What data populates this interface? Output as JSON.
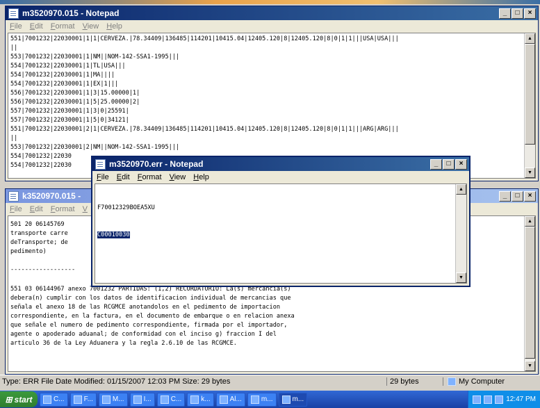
{
  "back_window": {
    "title": "m3520970.015 - Notepad",
    "menu": [
      "File",
      "Edit",
      "Format",
      "View",
      "Help"
    ],
    "lines": [
      "551|7001232|22030001|1|1|CERVEZA.|78.34409|136485|114201|10415.04|12405.120|8|12405.120|8|0|1|1|||USA|USA|||",
      "||",
      "553|7001232|22030001|1|NM||NOM-142-SSA1-1995|||",
      "554|7001232|22030001|1|TL|USA|||",
      "554|7001232|22030001|1|MA||||",
      "554|7001232|22030001|1|EX|1|||",
      "556|7001232|22030001|1|3|15.00000|1|",
      "556|7001232|22030001|1|5|25.00000|2|",
      "557|7001232|22030001|1|3|0|25591|",
      "557|7001232|22030001|1|5|0|34121|",
      "551|7001232|22030001|2|1|CERVEZA.|78.34409|136485|114201|10415.04|12405.120|8|12405.120|8|0|1|1|||ARG|ARG|||",
      "||",
      "553|7001232|22030001|2|NM||NOM-142-SSA1-1995|||",
      "554|7001232|22030",
      "554|7001232|22030"
    ]
  },
  "front_window": {
    "title": "k3520970.015 -",
    "menu": [
      "File",
      "Edit",
      "Format",
      "V"
    ],
    "lines_top": [
      "501 20 06145769",
      "transporte carre",
      "deTransporte; de",
      "pedimento)",
      "",
      "------------------"
    ],
    "lines_bottom": [
      "551 03 06144967 anexo 7001232 PARTIDAS: (1,2) RECORDATORIO: La(s) mercancia(s)",
      "debera(n) cumplir con los datos de identificacion individual de mercancias que",
      "señala el anexo 18 de las RCGMCE anotandolos en el pedimento de importacion",
      "correspondiente, en la factura, en el documento de embarque o en relacion anexa",
      "que señale el numero de pedimento correspondiente, firmada por el importador,",
      "agente o apoderado aduanal; de conformidad con el inciso g) fraccion I del",
      "articulo 36 de la Ley Aduanera y la regla 2.6.10 de las RCGMCE."
    ]
  },
  "err_window": {
    "title": "m3520970.err - Notepad",
    "menu": [
      "File",
      "Edit",
      "Format",
      "View",
      "Help"
    ],
    "line1": "F70012329BOEA5XU",
    "line2_selected": "C00010030"
  },
  "statusbar": {
    "info": "Type: ERR File Date Modified: 01/15/2007 12:03 PM Size: 29 bytes",
    "size": "29 bytes",
    "location": "My Computer"
  },
  "taskbar": {
    "start": "start",
    "items": [
      "C...",
      "F...",
      "M...",
      "I...",
      "C...",
      "k...",
      "Al...",
      "m...",
      "m..."
    ],
    "clock": "12:47 PM"
  }
}
